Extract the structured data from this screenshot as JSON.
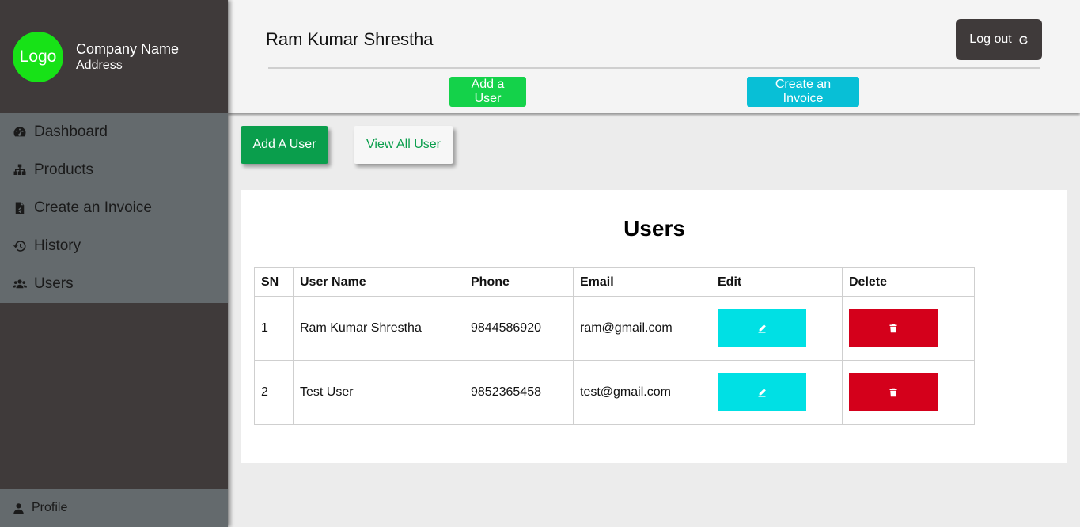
{
  "sidebar": {
    "logo_text": "Logo",
    "company_name": "Company Name",
    "company_address": "Address",
    "items": [
      {
        "label": "Dashboard",
        "icon": "dashboard-icon"
      },
      {
        "label": "Products",
        "icon": "sitemap-icon"
      },
      {
        "label": "Create an Invoice",
        "icon": "invoice-icon"
      },
      {
        "label": "History",
        "icon": "history-icon"
      },
      {
        "label": "Users",
        "icon": "users-icon"
      }
    ],
    "profile_label": "Profile"
  },
  "header": {
    "user_name": "Ram Kumar Shrestha",
    "logout_label": "Log out",
    "add_user_label": "Add a User",
    "create_invoice_label": "Create an Invoice"
  },
  "actions": {
    "add_user_label": "Add A User",
    "view_all_label": "View All User"
  },
  "users_table": {
    "title": "Users",
    "columns": [
      "SN",
      "User Name",
      "Phone",
      "Email",
      "Edit",
      "Delete"
    ],
    "rows": [
      {
        "sn": "1",
        "name": "Ram Kumar Shrestha",
        "phone": "9844586920",
        "email": "ram@gmail.com"
      },
      {
        "sn": "2",
        "name": "Test User",
        "phone": "9852365458",
        "email": "test@gmail.com"
      }
    ]
  },
  "colors": {
    "sidebar_bg": "#3f3a3a",
    "nav_bg": "#646a6d",
    "logo_green": "#17e217",
    "primary_green": "#0a9e4c",
    "header_add_green": "#14d24a",
    "invoice_cyan": "#08bfd6",
    "edit_cyan": "#00e0e4",
    "delete_red": "#d4001b"
  }
}
